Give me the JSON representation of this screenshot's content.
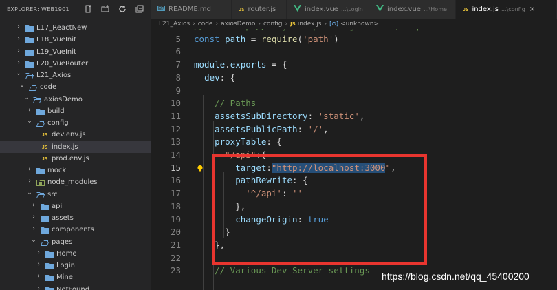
{
  "explorer": {
    "title": "EXPLORER: WEB1901"
  },
  "tree": [
    {
      "label": "L17_ReactNew",
      "depth": 1,
      "type": "folder",
      "open": false
    },
    {
      "label": "L18_VueInit",
      "depth": 1,
      "type": "folder",
      "open": false
    },
    {
      "label": "L19_VueInit",
      "depth": 1,
      "type": "folder",
      "open": false
    },
    {
      "label": "L20_VueRouter",
      "depth": 1,
      "type": "folder",
      "open": false
    },
    {
      "label": "L21_Axios",
      "depth": 1,
      "type": "folder",
      "open": true
    },
    {
      "label": "code",
      "depth": 2,
      "type": "folder",
      "open": true
    },
    {
      "label": "axiosDemo",
      "depth": 3,
      "type": "folder",
      "open": true
    },
    {
      "label": "build",
      "depth": 4,
      "type": "folder",
      "open": false
    },
    {
      "label": "config",
      "depth": 4,
      "type": "folder",
      "open": true
    },
    {
      "label": "dev.env.js",
      "depth": 5,
      "type": "js"
    },
    {
      "label": "index.js",
      "depth": 5,
      "type": "js",
      "selected": true
    },
    {
      "label": "prod.env.js",
      "depth": 5,
      "type": "js"
    },
    {
      "label": "mock",
      "depth": 4,
      "type": "folder",
      "open": false
    },
    {
      "label": "node_modules",
      "depth": 4,
      "type": "folder-special",
      "open": false
    },
    {
      "label": "src",
      "depth": 4,
      "type": "folder",
      "open": true
    },
    {
      "label": "api",
      "depth": 5,
      "type": "folder",
      "open": false
    },
    {
      "label": "assets",
      "depth": 5,
      "type": "folder",
      "open": false
    },
    {
      "label": "components",
      "depth": 5,
      "type": "folder",
      "open": false
    },
    {
      "label": "pages",
      "depth": 5,
      "type": "folder",
      "open": true
    },
    {
      "label": "Home",
      "depth": 6,
      "type": "folder",
      "open": false
    },
    {
      "label": "Login",
      "depth": 6,
      "type": "folder",
      "open": false
    },
    {
      "label": "Mine",
      "depth": 6,
      "type": "folder",
      "open": false
    },
    {
      "label": "NotFound",
      "depth": 6,
      "type": "folder",
      "open": false
    }
  ],
  "tabs": [
    {
      "label": "README.md",
      "desc": "",
      "icon": "md",
      "active": false
    },
    {
      "label": "router.js",
      "desc": "",
      "icon": "js",
      "active": false
    },
    {
      "label": "index.vue",
      "desc": "...\\Login",
      "icon": "vue",
      "active": false
    },
    {
      "label": "index.vue",
      "desc": "...\\Home",
      "icon": "vue",
      "active": false
    },
    {
      "label": "index.js",
      "desc": "...\\config",
      "icon": "js",
      "active": true
    }
  ],
  "breadcrumb": {
    "parts": [
      "L21_Axios",
      "code",
      "axiosDemo",
      "config"
    ],
    "file": "index.js",
    "symbol": "<unknown>"
  },
  "editor": {
    "current_line": "15",
    "lines": [
      {
        "n": "",
        "t": [
          [
            "c",
            "// see http://vuejs-templates.github.io/webpack for documentation."
          ]
        ]
      },
      {
        "n": "5",
        "t": [
          [
            "k",
            "const "
          ],
          [
            "v",
            "path"
          ],
          [
            "p",
            " = "
          ],
          [
            "f",
            "require"
          ],
          [
            "p",
            "("
          ],
          [
            "s",
            "'path'"
          ],
          [
            "p",
            ")"
          ]
        ]
      },
      {
        "n": "6",
        "t": []
      },
      {
        "n": "7",
        "t": [
          [
            "v",
            "module"
          ],
          [
            "p",
            "."
          ],
          [
            "v",
            "exports"
          ],
          [
            "p",
            " = {"
          ]
        ]
      },
      {
        "n": "8",
        "t": [
          [
            "p",
            "  "
          ],
          [
            "v",
            "dev"
          ],
          [
            "p",
            ": {"
          ]
        ]
      },
      {
        "n": "9",
        "t": []
      },
      {
        "n": "10",
        "t": [
          [
            "p",
            "    "
          ],
          [
            "c",
            "// Paths"
          ]
        ]
      },
      {
        "n": "11",
        "t": [
          [
            "p",
            "    "
          ],
          [
            "v",
            "assetsSubDirectory"
          ],
          [
            "p",
            ": "
          ],
          [
            "s",
            "'static'"
          ],
          [
            "p",
            ","
          ]
        ]
      },
      {
        "n": "12",
        "t": [
          [
            "p",
            "    "
          ],
          [
            "v",
            "assetsPublicPath"
          ],
          [
            "p",
            ": "
          ],
          [
            "s",
            "'/'"
          ],
          [
            "p",
            ","
          ]
        ]
      },
      {
        "n": "13",
        "t": [
          [
            "p",
            "    "
          ],
          [
            "v",
            "proxyTable"
          ],
          [
            "p",
            ": {"
          ]
        ]
      },
      {
        "n": "14",
        "t": [
          [
            "p",
            "      "
          ],
          [
            "s",
            "\"/api\""
          ],
          [
            "p",
            ":{"
          ]
        ]
      },
      {
        "n": "15",
        "t": [
          [
            "p",
            "        "
          ],
          [
            "v",
            "target"
          ],
          [
            "p",
            ":"
          ],
          [
            "s sel",
            "\"http://localhost:3000"
          ],
          [
            "s",
            "\""
          ],
          [
            "p",
            ","
          ]
        ]
      },
      {
        "n": "16",
        "t": [
          [
            "p",
            "        "
          ],
          [
            "v",
            "pathRewrite"
          ],
          [
            "p",
            ": {"
          ]
        ]
      },
      {
        "n": "17",
        "t": [
          [
            "p",
            "          "
          ],
          [
            "s",
            "'^/api'"
          ],
          [
            "p",
            ": "
          ],
          [
            "s",
            "''"
          ]
        ]
      },
      {
        "n": "18",
        "t": [
          [
            "p",
            "        },"
          ]
        ]
      },
      {
        "n": "19",
        "t": [
          [
            "p",
            "        "
          ],
          [
            "v",
            "changeOrigin"
          ],
          [
            "p",
            ": "
          ],
          [
            "k",
            "true"
          ]
        ]
      },
      {
        "n": "20",
        "t": [
          [
            "p",
            "      }"
          ]
        ]
      },
      {
        "n": "21",
        "t": [
          [
            "p",
            "    },"
          ]
        ]
      },
      {
        "n": "22",
        "t": []
      },
      {
        "n": "23",
        "t": [
          [
            "p",
            "    "
          ],
          [
            "c",
            "// Various Dev Server settings"
          ]
        ]
      }
    ]
  },
  "watermark": "https://blog.csdn.net/qq_45400200",
  "colors": {
    "highlight_box": "#e8352f",
    "selection": "#264f78",
    "js_badge": "#e8c33a",
    "vue_icon": "#41b883"
  }
}
